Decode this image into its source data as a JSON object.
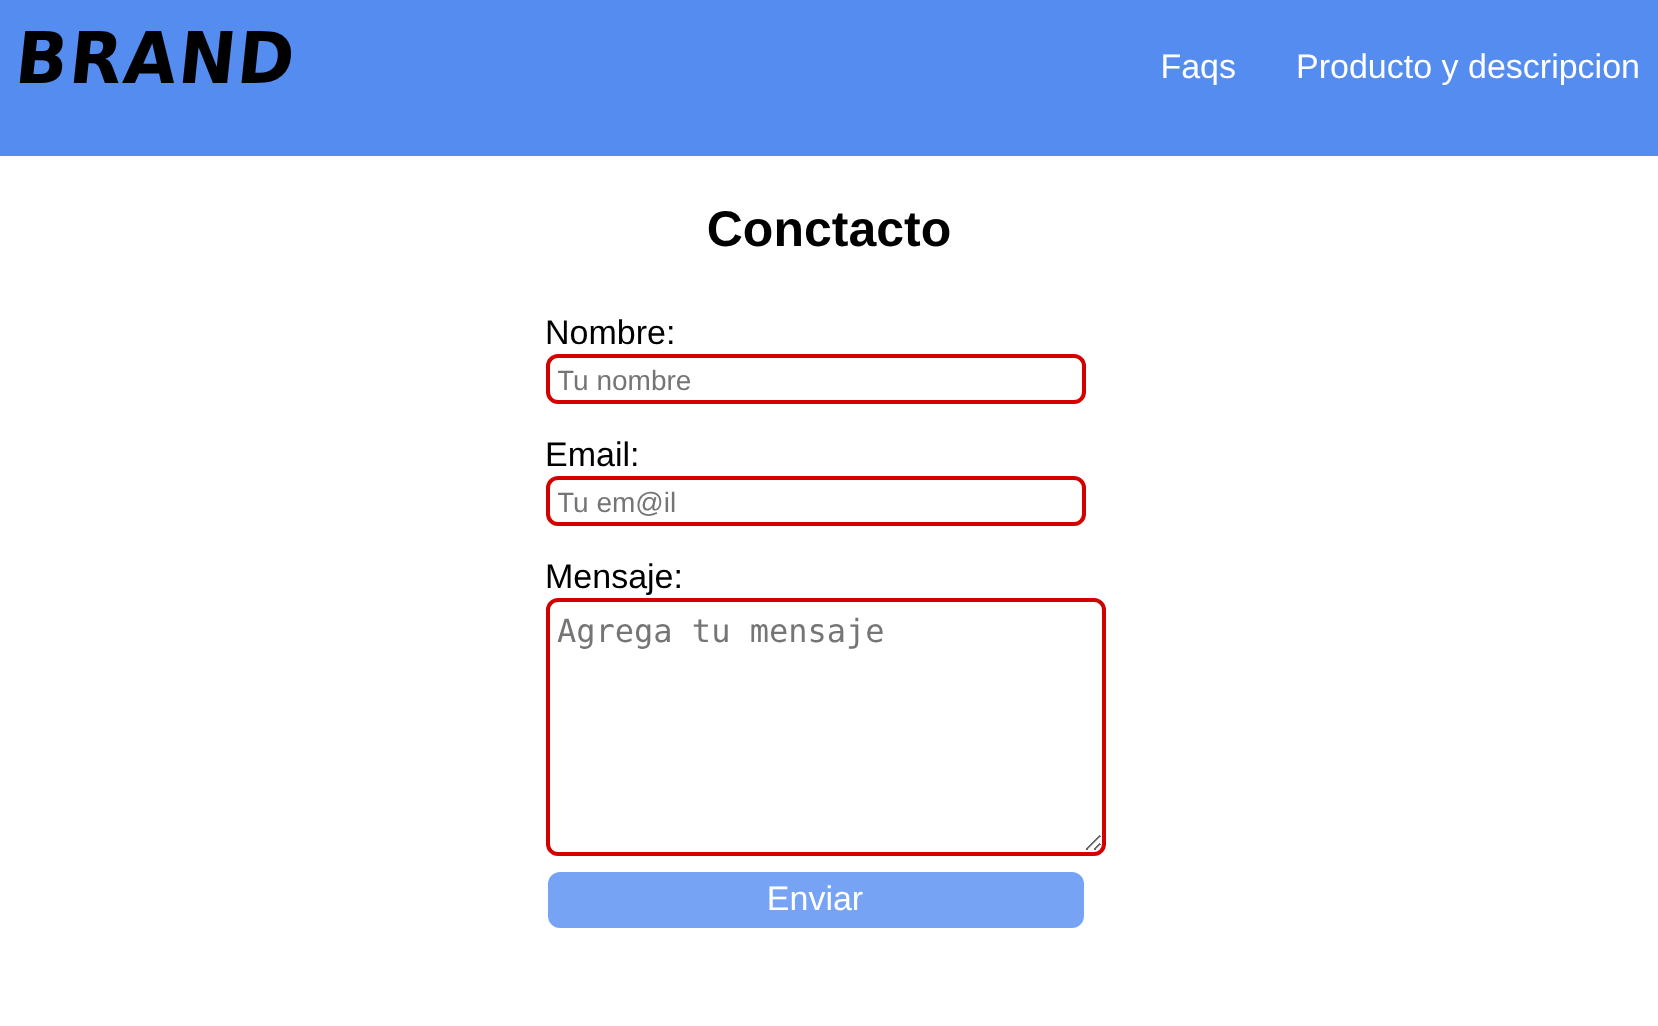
{
  "header": {
    "logo": "BRAND",
    "nav": [
      "Faqs",
      "Producto y descripcion"
    ]
  },
  "title": "Conctacto",
  "fields": [
    {
      "kind": "input",
      "label": "Nombre:",
      "placeholder": "Tu nombre"
    },
    {
      "kind": "input",
      "label": "Email:",
      "placeholder": "Tu em@il"
    },
    {
      "kind": "textarea",
      "label": "Mensaje:",
      "placeholder": "Agrega tu mensaje"
    }
  ],
  "submit": "Enviar"
}
